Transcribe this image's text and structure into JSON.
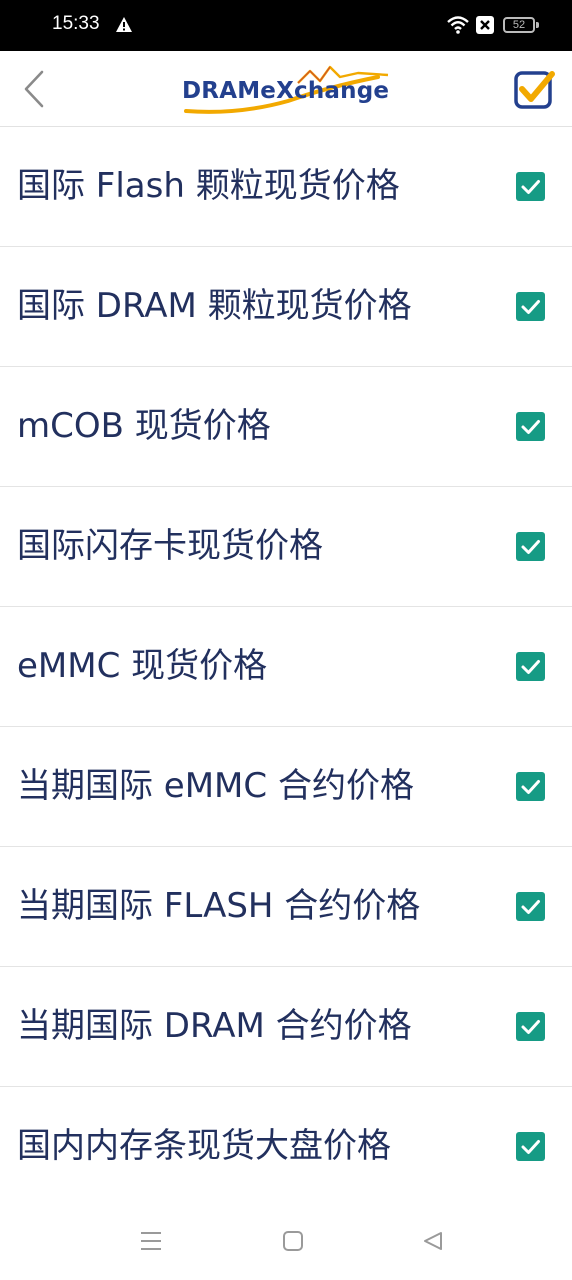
{
  "status_bar": {
    "time": "15:33",
    "battery": "52",
    "icons": [
      "warning-icon",
      "wifi-icon",
      "close-box-icon",
      "battery-icon"
    ]
  },
  "header": {
    "logo_text": "DRAMeXchange",
    "back_icon": "chevron-left-icon",
    "select_all_icon": "checkbox-checked-icon",
    "colors": {
      "brand_blue": "#23408e",
      "brand_orange": "#f2a900"
    }
  },
  "items": [
    {
      "label": "国际 Flash 颗粒现货价格",
      "checked": true
    },
    {
      "label": "国际 DRAM 颗粒现货价格",
      "checked": true
    },
    {
      "label": "mCOB 现货价格",
      "checked": true
    },
    {
      "label": "国际闪存卡现货价格",
      "checked": true
    },
    {
      "label": "eMMC 现货价格",
      "checked": true
    },
    {
      "label": "当期国际 eMMC 合约价格",
      "checked": true
    },
    {
      "label": "当期国际 FLASH 合约价格",
      "checked": true
    },
    {
      "label": "当期国际 DRAM 合约价格",
      "checked": true
    },
    {
      "label": "国内内存条现货大盘价格",
      "checked": true
    }
  ],
  "colors": {
    "checkbox": "#169b85",
    "text": "#22305e"
  },
  "nav_bar": {
    "icons": [
      "menu-icon",
      "home-square-icon",
      "back-triangle-icon"
    ]
  }
}
